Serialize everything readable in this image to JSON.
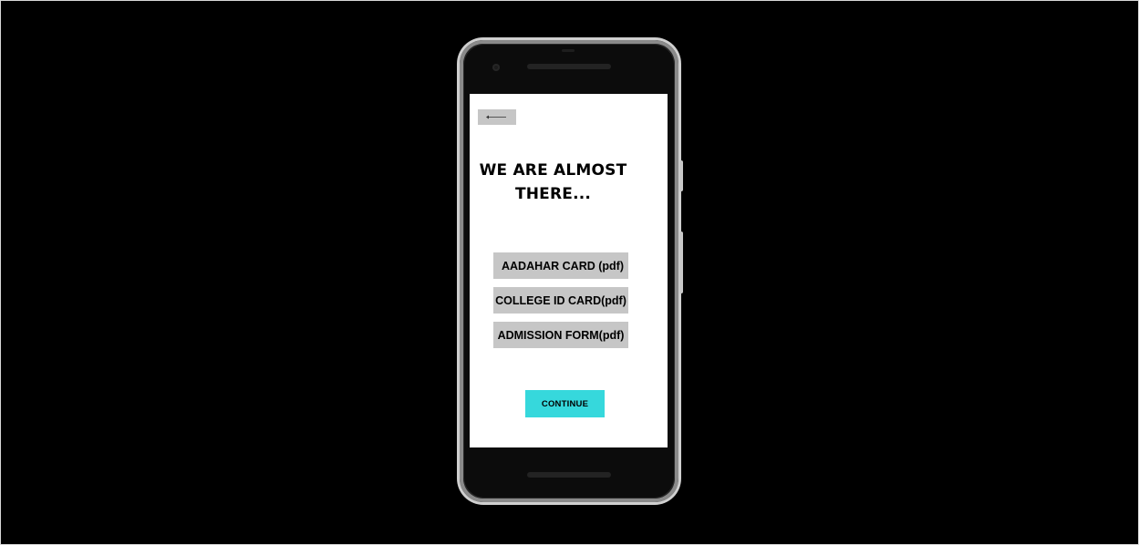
{
  "screen": {
    "back_icon": "arrow-left-icon",
    "title": "WE ARE ALMOST THERE...",
    "documents": [
      {
        "label": "AADAHAR CARD (pdf)"
      },
      {
        "label": "COLLEGE ID CARD(pdf)"
      },
      {
        "label": "ADMISSION FORM(pdf)"
      }
    ],
    "continue_label": "CONTINUE"
  },
  "colors": {
    "background": "#000000",
    "screen": "#ffffff",
    "button_gray": "#c6c6c6",
    "accent_cyan": "#36d8dc"
  }
}
